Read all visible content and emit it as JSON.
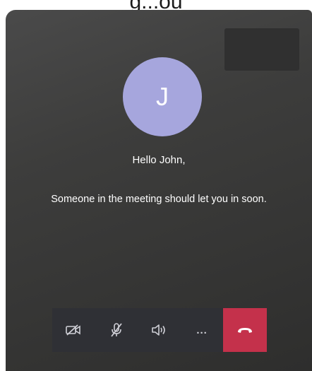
{
  "caption_fragment": "g...ou",
  "call": {
    "avatar_initial": "J",
    "greeting": "Hello John,",
    "status_message": "Someone in the meeting should let you in soon."
  },
  "toolbar": {
    "buttons": [
      {
        "name": "camera-off",
        "icon": "video-off-icon"
      },
      {
        "name": "mic-off",
        "icon": "mic-off-icon"
      },
      {
        "name": "speaker",
        "icon": "speaker-icon"
      },
      {
        "name": "more-options",
        "icon": "more-icon",
        "label": "..."
      },
      {
        "name": "hang-up",
        "icon": "hang-up-icon"
      }
    ]
  },
  "colors": {
    "avatar": "#a6a6dd",
    "toolbar": "#2f3035",
    "hangup": "#c4314b"
  }
}
